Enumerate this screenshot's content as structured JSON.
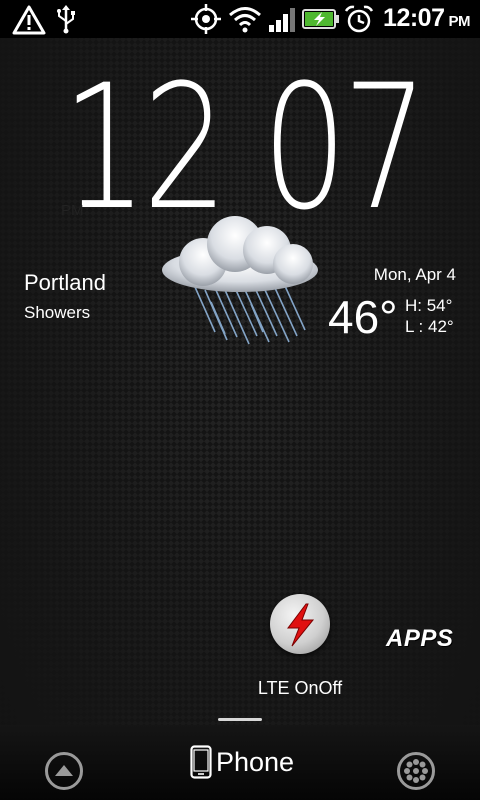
{
  "status_bar": {
    "time": "12:07",
    "ampm": "PM",
    "icons": [
      "warning-icon",
      "usb-icon",
      "gps-icon",
      "wifi-icon",
      "signal-icon",
      "battery-charging-icon",
      "alarm-icon"
    ]
  },
  "clock": {
    "hours": "12",
    "minutes": "07",
    "ampm": "PM"
  },
  "weather": {
    "city": "Portland",
    "condition": "Showers",
    "date": "Mon, Apr 4",
    "temperature": "46°",
    "high": "H: 54°",
    "low": "L : 42°",
    "icon": "rain-cloud-icon"
  },
  "shortcut": {
    "label": "LTE OnOff",
    "icon": "lightning-icon",
    "accent": "#e01010"
  },
  "apps": {
    "label": "APPS"
  },
  "dock": {
    "phone_label": "Phone",
    "left_icon": "up-arrow-icon",
    "right_icon": "personalize-icon"
  }
}
